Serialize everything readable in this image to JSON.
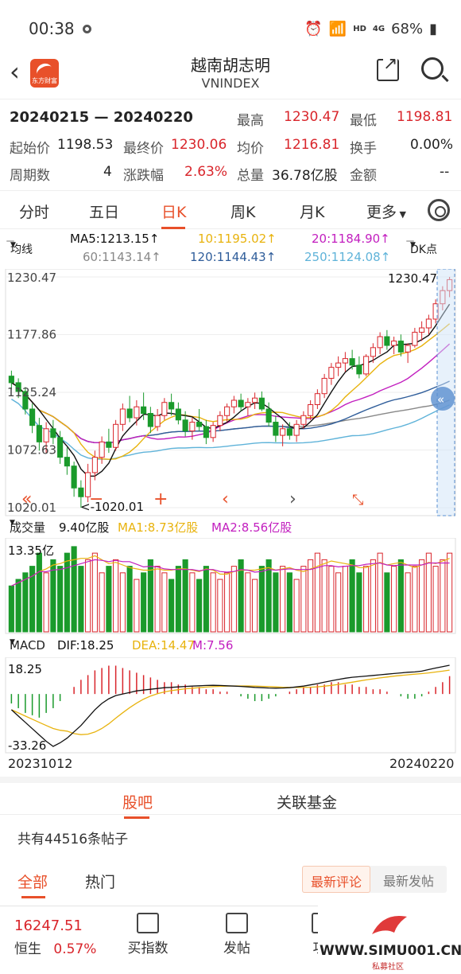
{
  "status_bar": {
    "time": "00:38",
    "network": "HD",
    "signal_label": "4G",
    "battery": "68%"
  },
  "header": {
    "title": "越南胡志明",
    "subtitle": "VNINDEX",
    "logo_text": "东方财富"
  },
  "info": {
    "date_range": "20240215 — 20240220",
    "high_label": "最高",
    "high": "1230.47",
    "low_label": "最低",
    "low": "1198.81",
    "open_label": "起始价",
    "open": "1198.53",
    "close_label": "最终价",
    "close": "1230.06",
    "avg_label": "均价",
    "avg": "1216.81",
    "turnover_label": "换手",
    "turnover": "0.00%",
    "periods_label": "周期数",
    "periods": "4",
    "change_label": "涨跌幅",
    "change": "2.63%",
    "volume_label": "总量",
    "volume": "36.78亿股",
    "amount_label": "金额",
    "amount": "--"
  },
  "tabs": [
    "分时",
    "五日",
    "日K",
    "周K",
    "月K",
    "更多"
  ],
  "active_tab": "日K",
  "ma_legend": {
    "dropdown": "均线",
    "ma5": "MA5:1213.15↑",
    "ma10": "10:1195.02↑",
    "ma20": "20:1184.90↑",
    "ma60": "60:1143.14↑",
    "ma120": "120:1144.43↑",
    "ma250": "250:1124.08↑",
    "dk_button": "DK点"
  },
  "chart_axis": {
    "y_labels": [
      "1230.47",
      "1177.86",
      "1125.24",
      "1072.63",
      "1020.01"
    ],
    "max_note": "1230.47",
    "min_note": "<-1020.01"
  },
  "volume_panel": {
    "dropdown": "成交量",
    "value": "9.40亿股",
    "ma1": "MA1:8.73亿股",
    "ma2": "MA2:8.56亿股",
    "axis_top": "13.35亿"
  },
  "macd_panel": {
    "dropdown": "MACD",
    "dif": "DIF:18.25",
    "dea": "DEA:14.47",
    "m": "M:7.56",
    "axis_top": "18.25",
    "axis_bottom": "-33.26"
  },
  "date_axis": {
    "start": "20231012",
    "end": "20240220"
  },
  "section_tabs": [
    "股吧",
    "关联基金"
  ],
  "post_count": "共有44516条帖子",
  "filters": {
    "all": "全部",
    "hot": "热门",
    "sort_latest_comment": "最新评论",
    "sort_latest_post": "最新发帖"
  },
  "bottom_bar": {
    "index_value": "16247.51",
    "index_name": "恒生",
    "index_change": "0.57%",
    "buy_fund": "买指数",
    "post": "发帖",
    "more": "功"
  },
  "watermark": {
    "url": "WWW.SIMU001.CN",
    "text": "私募社区"
  },
  "chart_data": {
    "type": "candlestick",
    "ylim": [
      1020.01,
      1230.47
    ],
    "colors": {
      "up": "#d9252b",
      "down": "#1a9a2b",
      "ma5": "#111111",
      "ma10": "#e8b30e",
      "ma20": "#c21fbf",
      "ma60": "#888888",
      "ma120": "#2f5d9a",
      "ma250": "#5fb3d9"
    },
    "ohlc": [
      [
        1140,
        1145,
        1128,
        1134
      ],
      [
        1134,
        1138,
        1120,
        1126
      ],
      [
        1126,
        1130,
        1105,
        1110
      ],
      [
        1110,
        1115,
        1088,
        1095
      ],
      [
        1095,
        1102,
        1072,
        1080
      ],
      [
        1080,
        1098,
        1070,
        1092
      ],
      [
        1092,
        1100,
        1078,
        1084
      ],
      [
        1084,
        1090,
        1060,
        1066
      ],
      [
        1066,
        1075,
        1050,
        1058
      ],
      [
        1058,
        1062,
        1030,
        1038
      ],
      [
        1038,
        1045,
        1020,
        1030
      ],
      [
        1030,
        1060,
        1025,
        1052
      ],
      [
        1052,
        1072,
        1045,
        1066
      ],
      [
        1066,
        1085,
        1060,
        1080
      ],
      [
        1080,
        1092,
        1070,
        1075
      ],
      [
        1075,
        1100,
        1072,
        1096
      ],
      [
        1096,
        1115,
        1090,
        1110
      ],
      [
        1110,
        1122,
        1098,
        1102
      ],
      [
        1102,
        1118,
        1095,
        1112
      ],
      [
        1112,
        1125,
        1100,
        1106
      ],
      [
        1106,
        1112,
        1088,
        1094
      ],
      [
        1094,
        1110,
        1090,
        1104
      ],
      [
        1104,
        1120,
        1100,
        1116
      ],
      [
        1116,
        1124,
        1104,
        1110
      ],
      [
        1110,
        1116,
        1096,
        1100
      ],
      [
        1100,
        1108,
        1085,
        1090
      ],
      [
        1090,
        1102,
        1082,
        1098
      ],
      [
        1098,
        1110,
        1090,
        1094
      ],
      [
        1094,
        1100,
        1078,
        1084
      ],
      [
        1084,
        1098,
        1080,
        1095
      ],
      [
        1095,
        1108,
        1090,
        1104
      ],
      [
        1104,
        1115,
        1098,
        1112
      ],
      [
        1112,
        1122,
        1106,
        1118
      ],
      [
        1118,
        1124,
        1108,
        1112
      ],
      [
        1112,
        1120,
        1104,
        1116
      ],
      [
        1116,
        1125,
        1110,
        1120
      ],
      [
        1120,
        1126,
        1108,
        1110
      ],
      [
        1110,
        1116,
        1094,
        1098
      ],
      [
        1098,
        1104,
        1080,
        1086
      ],
      [
        1086,
        1096,
        1076,
        1092
      ],
      [
        1092,
        1098,
        1082,
        1086
      ],
      [
        1086,
        1100,
        1080,
        1096
      ],
      [
        1096,
        1108,
        1092,
        1104
      ],
      [
        1104,
        1118,
        1100,
        1114
      ],
      [
        1114,
        1128,
        1110,
        1124
      ],
      [
        1124,
        1142,
        1120,
        1138
      ],
      [
        1138,
        1152,
        1132,
        1148
      ],
      [
        1148,
        1158,
        1140,
        1152
      ],
      [
        1152,
        1162,
        1144,
        1156
      ],
      [
        1156,
        1164,
        1146,
        1150
      ],
      [
        1150,
        1158,
        1138,
        1142
      ],
      [
        1142,
        1160,
        1140,
        1158
      ],
      [
        1158,
        1170,
        1152,
        1166
      ],
      [
        1166,
        1180,
        1160,
        1176
      ],
      [
        1176,
        1182,
        1164,
        1168
      ],
      [
        1168,
        1176,
        1160,
        1172
      ],
      [
        1172,
        1178,
        1158,
        1162
      ],
      [
        1162,
        1170,
        1152,
        1168
      ],
      [
        1168,
        1184,
        1166,
        1180
      ],
      [
        1180,
        1190,
        1172,
        1184
      ],
      [
        1184,
        1196,
        1178,
        1192
      ],
      [
        1192,
        1210,
        1188,
        1206
      ],
      [
        1206,
        1222,
        1200,
        1218
      ],
      [
        1218,
        1230.47,
        1212,
        1228
      ]
    ],
    "volume": [
      7,
      8,
      9,
      10,
      12,
      9,
      11,
      10,
      12,
      13,
      10,
      11,
      12,
      9,
      10,
      11,
      9,
      10,
      8,
      9,
      11,
      10,
      9,
      8,
      10,
      11,
      9,
      8,
      10,
      9,
      8,
      9,
      10,
      11,
      9,
      8,
      10,
      11,
      9,
      10,
      9,
      8,
      10,
      11,
      12,
      11,
      10,
      9,
      10,
      11,
      9,
      10,
      11,
      12,
      9,
      10,
      11,
      9,
      10,
      11,
      12,
      10,
      11,
      12
    ],
    "macd_hist": [
      -4,
      -6,
      -8,
      -9,
      -10,
      -8,
      -6,
      -3,
      0,
      3,
      6,
      8,
      10,
      11,
      12,
      12,
      11,
      10,
      9,
      8,
      7,
      6,
      5,
      5,
      4,
      4,
      3,
      3,
      2,
      2,
      1,
      1,
      0,
      -1,
      -2,
      -3,
      -3,
      -2,
      -1,
      0,
      1,
      2,
      3,
      3,
      4,
      4,
      5,
      5,
      4,
      4,
      3,
      3,
      2,
      2,
      1,
      0,
      -1,
      -2,
      -2,
      -1,
      1,
      3,
      5,
      7.56
    ],
    "dif": [
      -10,
      -14,
      -18,
      -22,
      -26,
      -30,
      -33.26,
      -31,
      -28,
      -24,
      -20,
      -15,
      -10,
      -6,
      -3,
      -1,
      0,
      1,
      2,
      2.5,
      3,
      3.5,
      4,
      4.2,
      4.5,
      4.8,
      5,
      5.2,
      5.4,
      5.5,
      5.4,
      5.2,
      5,
      4.8,
      4.5,
      4.2,
      4,
      3.8,
      3.7,
      3.8,
      4,
      4.5,
      5,
      5.8,
      6.6,
      7.5,
      8.4,
      9.2,
      10,
      10.6,
      11,
      11.4,
      11.8,
      12.2,
      12.6,
      13,
      13.4,
      13.8,
      14,
      14.5,
      15.5,
      16.5,
      17.4,
      18.25
    ]
  }
}
